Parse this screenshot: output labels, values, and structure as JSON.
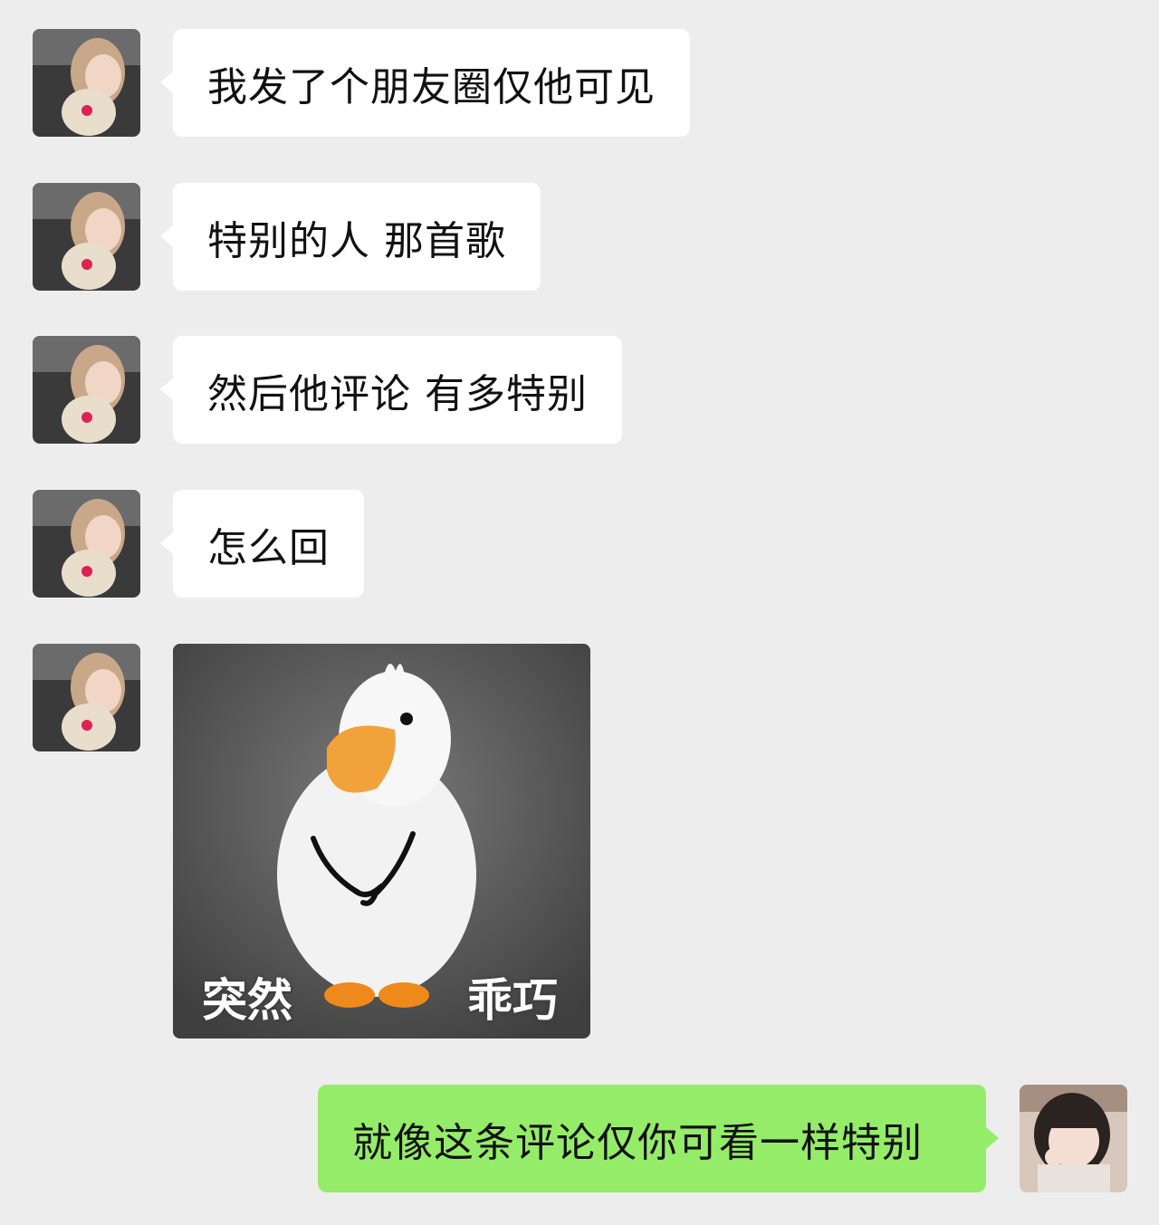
{
  "messages": [
    {
      "side": "in",
      "text": "我发了个朋友圈仅他可见"
    },
    {
      "side": "in",
      "text": "特别的人 那首歌"
    },
    {
      "side": "in",
      "text": "然后他评论 有多特别"
    },
    {
      "side": "in",
      "text": "怎么回"
    },
    {
      "side": "in",
      "type": "sticker",
      "sticker_icon": "duck-sticker",
      "caption_left": "突然",
      "caption_right": "乖巧"
    },
    {
      "side": "out",
      "text": "就像这条评论仅你可看一样特别"
    }
  ],
  "colors": {
    "background": "#ededed",
    "incoming_bubble": "#ffffff",
    "outgoing_bubble": "#95ec69"
  }
}
